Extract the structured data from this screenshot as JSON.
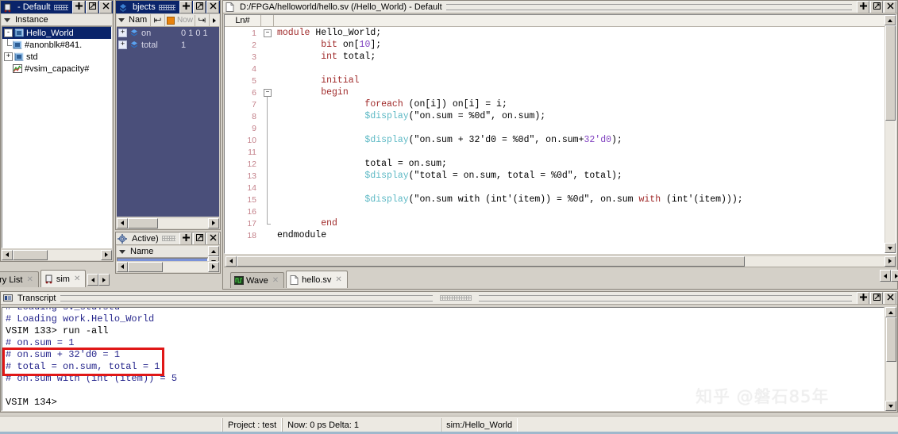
{
  "instance_panel": {
    "title": "- Default",
    "column_header": "Instance",
    "buttons": [
      "dock-button",
      "undock-button",
      "close-button"
    ],
    "rows": [
      {
        "label": "Hello_World",
        "indent": 0,
        "expander": "-",
        "selected": true,
        "icon": "module-icon"
      },
      {
        "label": "#anonblk#841.",
        "indent": 1,
        "expander": "",
        "selected": false,
        "icon": "module-icon"
      },
      {
        "label": "std",
        "indent": 0,
        "expander": "+",
        "selected": false,
        "icon": "module-icon"
      },
      {
        "label": "#vsim_capacity#",
        "indent": 0,
        "expander": "",
        "selected": false,
        "icon": "capacity-icon"
      }
    ],
    "tabs": [
      {
        "label": "ory List",
        "active": false
      },
      {
        "label": "sim",
        "active": true
      }
    ]
  },
  "objects_panel": {
    "title": "bjects",
    "column_header": "Nam",
    "now_label": "Now",
    "rows": [
      {
        "name": "on",
        "value": "0 1 0 1",
        "expander": "+"
      },
      {
        "name": "total",
        "value": "1",
        "expander": "+"
      }
    ]
  },
  "processes_panel": {
    "title": "Active)",
    "column_header": "Name"
  },
  "editor": {
    "title": "D:/FPGA/helloworld/hello.sv (/Hello_World) - Default",
    "line_header": "Ln#",
    "lines": [
      {
        "n": "1",
        "fold": "minus",
        "indent": 0,
        "tokens": [
          {
            "t": "module ",
            "c": "k"
          },
          {
            "t": "Hello_World;",
            "c": "pl"
          }
        ]
      },
      {
        "n": "2",
        "fold": "",
        "indent": 0,
        "tokens": [
          {
            "t": "        ",
            "c": "pl"
          },
          {
            "t": "bit ",
            "c": "k"
          },
          {
            "t": "on[",
            "c": "pl"
          },
          {
            "t": "10",
            "c": "n"
          },
          {
            "t": "];",
            "c": "pl"
          }
        ]
      },
      {
        "n": "3",
        "fold": "",
        "indent": 0,
        "tokens": [
          {
            "t": "        ",
            "c": "pl"
          },
          {
            "t": "int ",
            "c": "k"
          },
          {
            "t": "total;",
            "c": "pl"
          }
        ]
      },
      {
        "n": "4",
        "fold": "",
        "indent": 0,
        "tokens": []
      },
      {
        "n": "5",
        "fold": "",
        "indent": 0,
        "tokens": [
          {
            "t": "        ",
            "c": "pl"
          },
          {
            "t": "initial",
            "c": "k"
          }
        ]
      },
      {
        "n": "6",
        "fold": "minus2",
        "indent": 0,
        "tokens": [
          {
            "t": "        ",
            "c": "pl"
          },
          {
            "t": "begin",
            "c": "k"
          }
        ]
      },
      {
        "n": "7",
        "fold": "bar",
        "indent": 0,
        "tokens": [
          {
            "t": "                ",
            "c": "pl"
          },
          {
            "t": "foreach ",
            "c": "k"
          },
          {
            "t": "(on[i]) on[i] = i;",
            "c": "pl"
          }
        ]
      },
      {
        "n": "8",
        "fold": "bar",
        "indent": 0,
        "tokens": [
          {
            "t": "                ",
            "c": "pl"
          },
          {
            "t": "$display",
            "c": "cy"
          },
          {
            "t": "(\"on.sum = %0d\", on.sum);",
            "c": "pl"
          }
        ]
      },
      {
        "n": "9",
        "fold": "bar",
        "indent": 0,
        "tokens": []
      },
      {
        "n": "10",
        "fold": "bar",
        "indent": 0,
        "tokens": [
          {
            "t": "                ",
            "c": "pl"
          },
          {
            "t": "$display",
            "c": "cy"
          },
          {
            "t": "(\"on.sum + 32'd0 = %0d\", on.sum+",
            "c": "pl"
          },
          {
            "t": "32'd0",
            "c": "n"
          },
          {
            "t": ");",
            "c": "pl"
          }
        ]
      },
      {
        "n": "11",
        "fold": "bar",
        "indent": 0,
        "tokens": []
      },
      {
        "n": "12",
        "fold": "bar",
        "indent": 0,
        "tokens": [
          {
            "t": "                ",
            "c": "pl"
          },
          {
            "t": "total = on.sum;",
            "c": "pl"
          }
        ]
      },
      {
        "n": "13",
        "fold": "bar",
        "indent": 0,
        "tokens": [
          {
            "t": "                ",
            "c": "pl"
          },
          {
            "t": "$display",
            "c": "cy"
          },
          {
            "t": "(\"total = on.sum, total = %0d\", total);",
            "c": "pl"
          }
        ]
      },
      {
        "n": "14",
        "fold": "bar",
        "indent": 0,
        "tokens": []
      },
      {
        "n": "15",
        "fold": "bar",
        "indent": 0,
        "tokens": [
          {
            "t": "                ",
            "c": "pl"
          },
          {
            "t": "$display",
            "c": "cy"
          },
          {
            "t": "(\"on.sum with (int'(item)) = %0d\", on.sum ",
            "c": "pl"
          },
          {
            "t": "with",
            "c": "k"
          },
          {
            "t": " (int'(item)));",
            "c": "pl"
          }
        ]
      },
      {
        "n": "16",
        "fold": "bar",
        "indent": 0,
        "tokens": []
      },
      {
        "n": "17",
        "fold": "endbar",
        "indent": 0,
        "tokens": [
          {
            "t": "        ",
            "c": "pl"
          },
          {
            "t": "end",
            "c": "k"
          }
        ]
      },
      {
        "n": "18",
        "fold": "",
        "indent": 0,
        "tokens": [
          {
            "t": "endmodule",
            "c": "pl"
          }
        ]
      }
    ],
    "tabs": [
      {
        "label": "Wave",
        "active": false,
        "icon": "wave-icon"
      },
      {
        "label": "hello.sv",
        "active": true,
        "icon": "file-icon"
      }
    ]
  },
  "transcript": {
    "title": "Transcript",
    "lines": [
      {
        "text": "# Loading sv_std.std",
        "kind": "out",
        "clipped": true
      },
      {
        "text": "# Loading work.Hello_World",
        "kind": "out"
      },
      {
        "text": "VSIM 133> run -all",
        "kind": "cmd"
      },
      {
        "text": "# on.sum = 1",
        "kind": "out"
      },
      {
        "text": "# on.sum + 32'd0 = 1",
        "kind": "out"
      },
      {
        "text": "# total = on.sum, total = 1",
        "kind": "out"
      },
      {
        "text": "# on.sum with (int'(item)) = 5",
        "kind": "out"
      },
      {
        "text": "",
        "kind": "out"
      },
      {
        "text": "VSIM 134>",
        "kind": "cmd"
      }
    ],
    "highlight_color": "#e01717"
  },
  "watermark": "知乎 @磐石85年",
  "status_bar": {
    "project": "Project : test",
    "now": "Now: 0 ps  Delta: 1",
    "context": "sim:/Hello_World"
  }
}
